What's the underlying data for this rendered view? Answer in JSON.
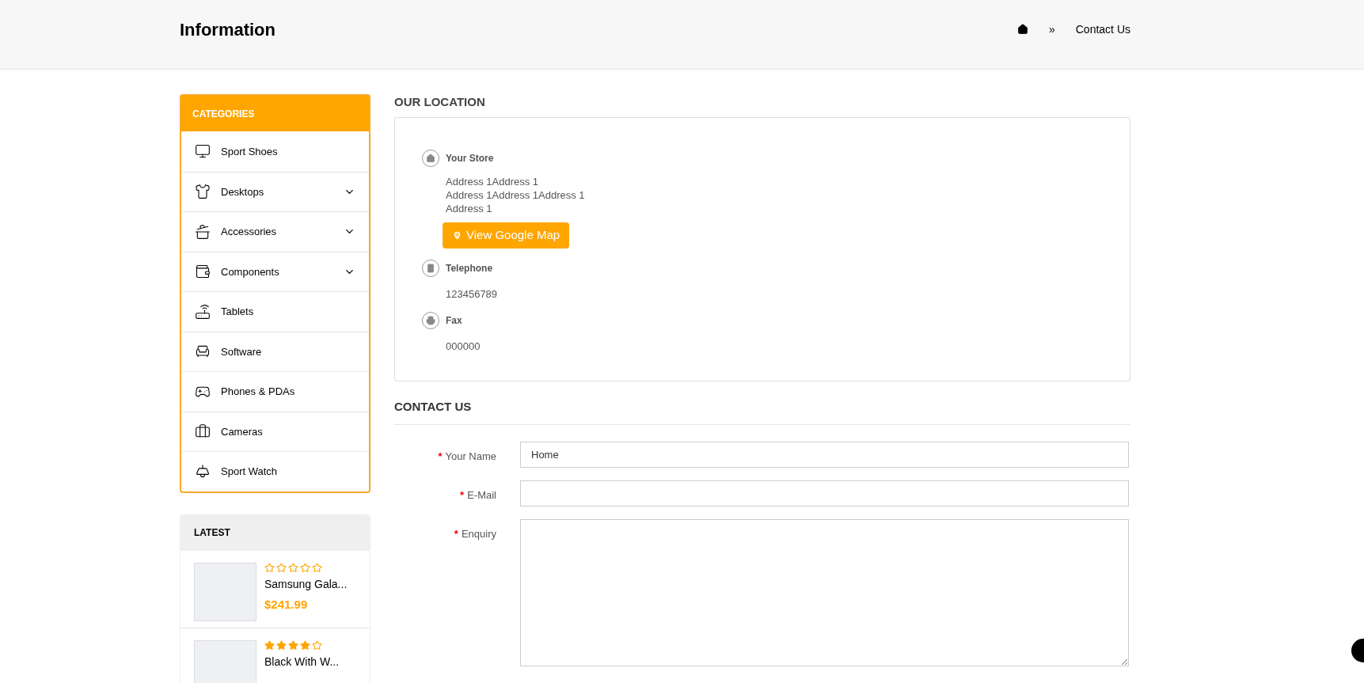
{
  "header": {
    "title": "Information",
    "breadcrumb": {
      "separator": "»",
      "current": "Contact Us"
    }
  },
  "categories": {
    "title": "CATEGORIES",
    "items": [
      {
        "label": "Sport Shoes",
        "has_submenu": false
      },
      {
        "label": "Desktops",
        "has_submenu": true
      },
      {
        "label": "Accessories",
        "has_submenu": true
      },
      {
        "label": "Components",
        "has_submenu": true
      },
      {
        "label": "Tablets",
        "has_submenu": false
      },
      {
        "label": "Software",
        "has_submenu": false
      },
      {
        "label": "Phones & PDAs",
        "has_submenu": false
      },
      {
        "label": "Cameras",
        "has_submenu": false
      },
      {
        "label": "Sport Watch",
        "has_submenu": false
      }
    ]
  },
  "latest": {
    "title": "LATEST",
    "products": [
      {
        "name": "Samsung Gala...",
        "stars": 0,
        "price": "$241.99"
      },
      {
        "name": "Black With W...",
        "stars": 4
      }
    ]
  },
  "location": {
    "title": "OUR LOCATION",
    "store": {
      "label": "Your Store",
      "address": [
        "Address 1Address 1",
        "Address 1Address 1Address 1",
        "Address 1"
      ],
      "map_button": "View Google Map"
    },
    "telephone": {
      "label": "Telephone",
      "value": "123456789"
    },
    "fax": {
      "label": "Fax",
      "value": "000000"
    }
  },
  "contact": {
    "title": "CONTACT US",
    "fields": [
      {
        "kind": "text",
        "label": "Your Name",
        "required_mark": "*",
        "value": "Home"
      },
      {
        "kind": "text",
        "label": "E-Mail",
        "required_mark": "*"
      },
      {
        "kind": "textarea",
        "label": "Enquiry",
        "required_mark": "*"
      }
    ]
  }
}
